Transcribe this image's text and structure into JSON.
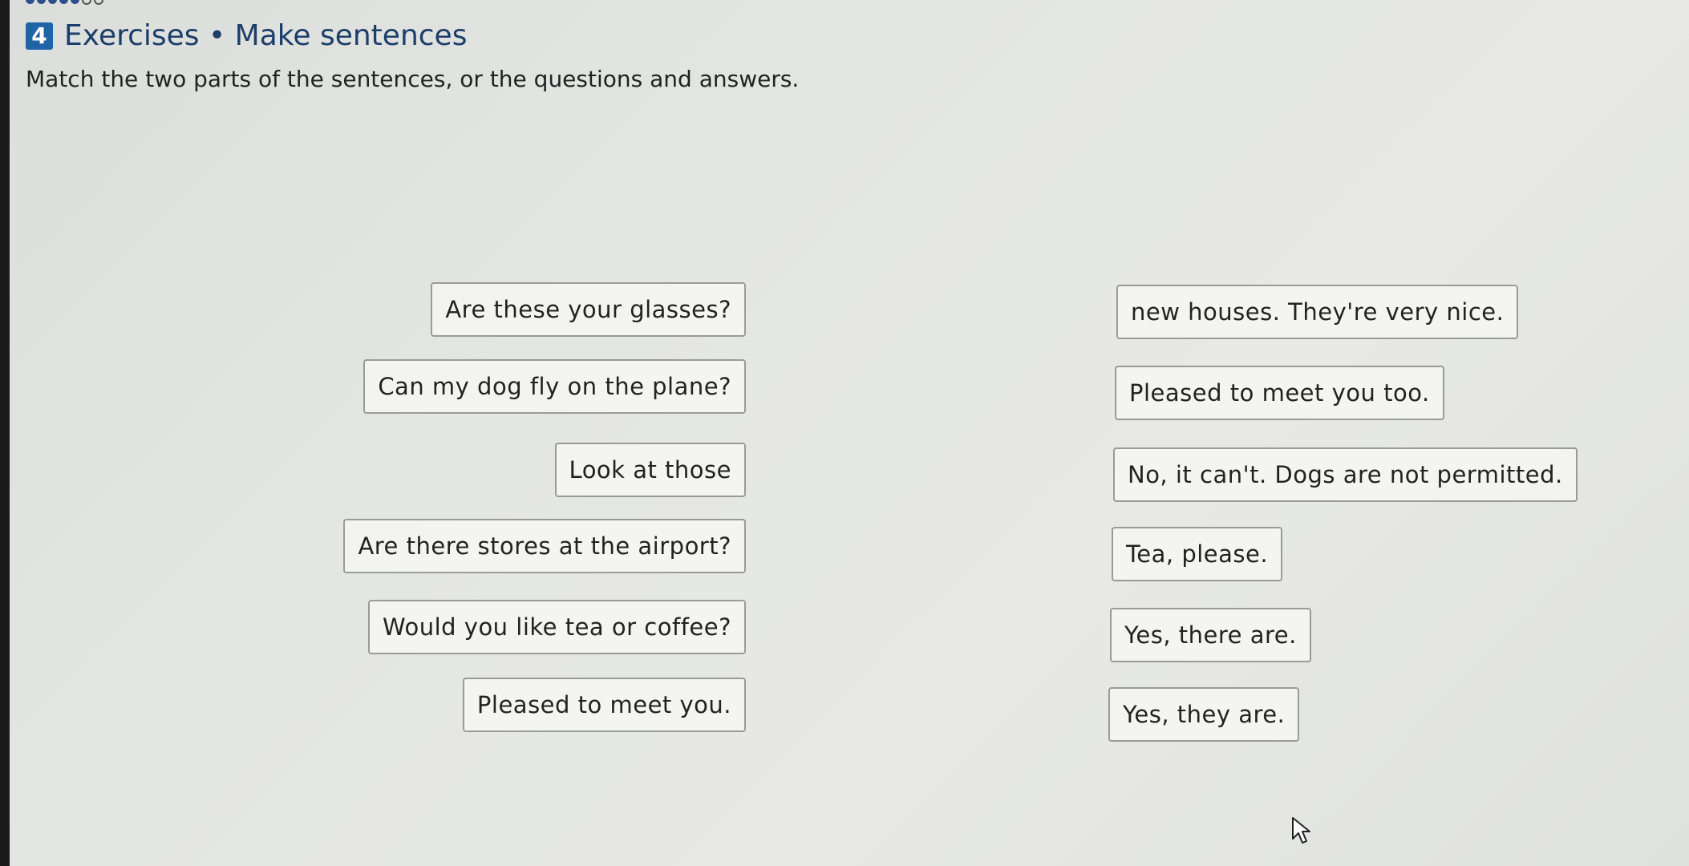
{
  "header": {
    "number": "4",
    "title": "Exercises • Make sentences",
    "instruction": "Match the two parts of the sentences, or the questions and answers."
  },
  "left_items": [
    "Are these your glasses?",
    "Can my dog fly on the plane?",
    "Look at those",
    "Are there stores at the airport?",
    "Would you like tea or coffee?",
    "Pleased to meet you."
  ],
  "right_items": [
    "new houses. They're very nice.",
    "Pleased to meet you too.",
    "No, it can't. Dogs are not permitted.",
    "Tea, please.",
    "Yes, there are.",
    "Yes, they are."
  ],
  "icons": {
    "cursor": "mouse-pointer-icon",
    "progress": "progress-dots-icon"
  },
  "colors": {
    "number_badge": "#1f63a8",
    "title": "#1c3e6b"
  }
}
